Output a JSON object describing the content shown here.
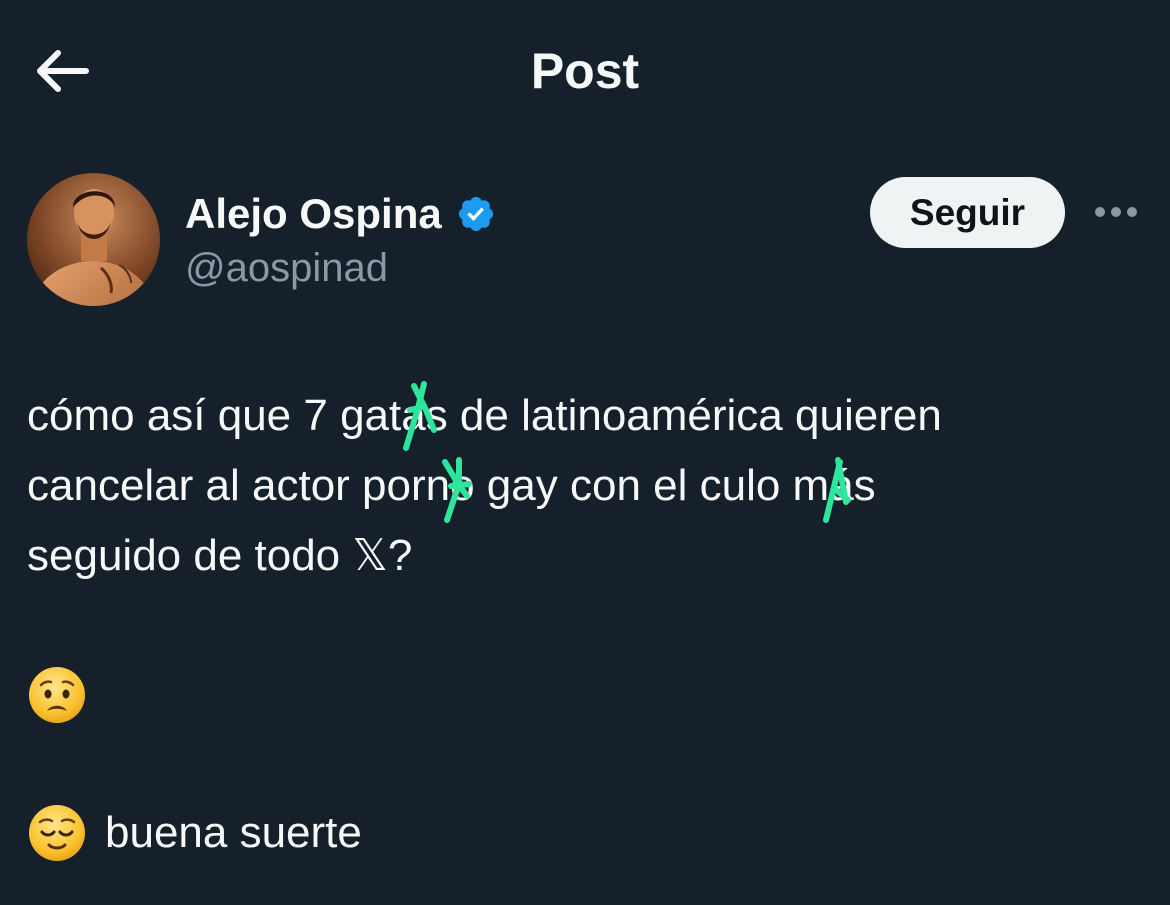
{
  "header": {
    "title": "Post",
    "back_icon": "arrow-left-icon"
  },
  "author": {
    "display_name": "Alejo Ospina",
    "handle": "@aospinad",
    "verified_icon": "verified-badge-icon",
    "follow_label": "Seguir",
    "more_icon": "more-horizontal-icon"
  },
  "post": {
    "line1": "cómo así que 7 gatas de latinoamérica quieren",
    "line2": "cancelar al actor porno gay con el culo más",
    "line3_text": "seguido de todo ",
    "line3_logo": "𝕏",
    "line3_end": "?",
    "emoji1": "worried-face-emoji",
    "emoji2": "relieved-face-emoji",
    "emoji2_text": "buena suerte"
  },
  "colors": {
    "background": "#15202b",
    "text": "#f7f9f9",
    "muted": "#8b98a5",
    "verified": "#1d9bf0",
    "scribble": "#2ee59d"
  }
}
